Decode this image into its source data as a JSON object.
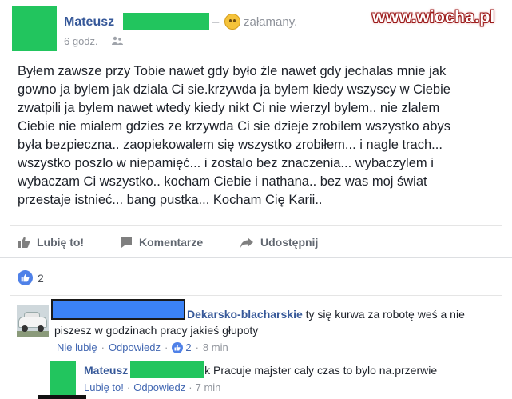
{
  "post": {
    "author": "Mateusz",
    "feeling_dash": "–",
    "feeling": "załamany.",
    "time": "6 godz.",
    "body": "Byłem zawsze przy Tobie nawet gdy było źle nawet gdy jechalas mnie jak\ngowno ja bylem jak dziala Ci sie.krzywda ja bylem kiedy wszyscy w Ciebie\nzwatpili ja bylem nawet wtedy kiedy nikt Ci nie wierzyl bylem.. nie zlalem\nCiebie nie mialem gdzies ze krzywda Ci sie dzieje zrobilem wszystko abys\nbyła bezpieczna.. zaopiekowalem się wszystko zrobiłem... i nagle trach...\nwszystko poszlo w niepamięć... i zostalo bez znaczenia... wybaczylem i\nwybaczam Ci wszystko.. kocham Ciebie i nathana.. bez was moj świat\nprzestaje istnieć... bang pustka... Kocham Cię Karii.."
  },
  "watermark": "www.wiocha.pl",
  "actions": {
    "like": "Lubię to!",
    "comment": "Komentarze",
    "share": "Udostępnij"
  },
  "reactions": {
    "count": "2"
  },
  "comments": [
    {
      "author": "Dekarsko-blacharskie",
      "text": "ty się kurwa za robotę weś a nie pisze\u0000",
      "meta": {
        "unlike": "Nie lubię",
        "reply": "Odpowiedz",
        "likes": "2",
        "time": "8 min"
      }
    }
  ],
  "comment1_full": {
    "line1": "ty się kurwa za robotę weś a nie",
    "line2": "piszesz w godzinach pracy jakieś głupoty"
  },
  "reply": {
    "author": "Mateusz",
    "text": "k Pracuje majster caly czas to bylo na.przerwie",
    "like": "Lubię to!",
    "reply": "Odpowiedz",
    "time": "7 min"
  },
  "colors": {
    "link": "#365899",
    "meta": "#90949c",
    "like_blue": "#4f81e8",
    "redact_green": "#22c55e",
    "redact_blue": "#3b82f6"
  },
  "icons": [
    "privacy-icon",
    "like-icon",
    "comment-icon",
    "share-icon",
    "feeling-icon"
  ]
}
